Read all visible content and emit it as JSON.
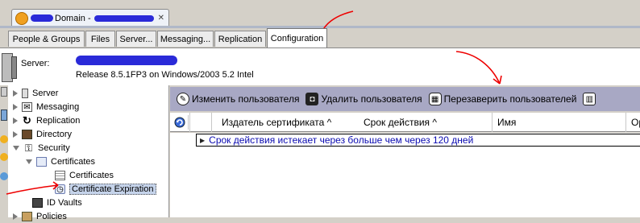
{
  "window_tab": {
    "title": "Domain -"
  },
  "tabs": [
    {
      "label": "People & Groups"
    },
    {
      "label": "Files"
    },
    {
      "label": "Server..."
    },
    {
      "label": "Messaging..."
    },
    {
      "label": "Replication"
    },
    {
      "label": "Configuration"
    }
  ],
  "server": {
    "label": "Server:",
    "release": "Release 8.5.1FP3 on Windows/2003 5.2 Intel"
  },
  "tree": {
    "items": [
      {
        "label": "Server"
      },
      {
        "label": "Messaging"
      },
      {
        "label": "Replication"
      },
      {
        "label": "Directory"
      },
      {
        "label": "Security"
      },
      {
        "label": "Certificates"
      },
      {
        "label": "Certificates"
      },
      {
        "label": "Certificate Expiration"
      },
      {
        "label": "ID Vaults"
      },
      {
        "label": "Policies"
      }
    ]
  },
  "actions": [
    {
      "label": "Изменить пользователя"
    },
    {
      "label": "Удалить пользователя"
    },
    {
      "label": "Перезаверить пользователей"
    }
  ],
  "table": {
    "columns": [
      {
        "label": "Издатель сертификата ^"
      },
      {
        "label": "Срок действия ^"
      },
      {
        "label": "Имя"
      },
      {
        "label": "Органи"
      }
    ],
    "group_row": "Срок действия истекает через больше чем через 120 дней"
  }
}
